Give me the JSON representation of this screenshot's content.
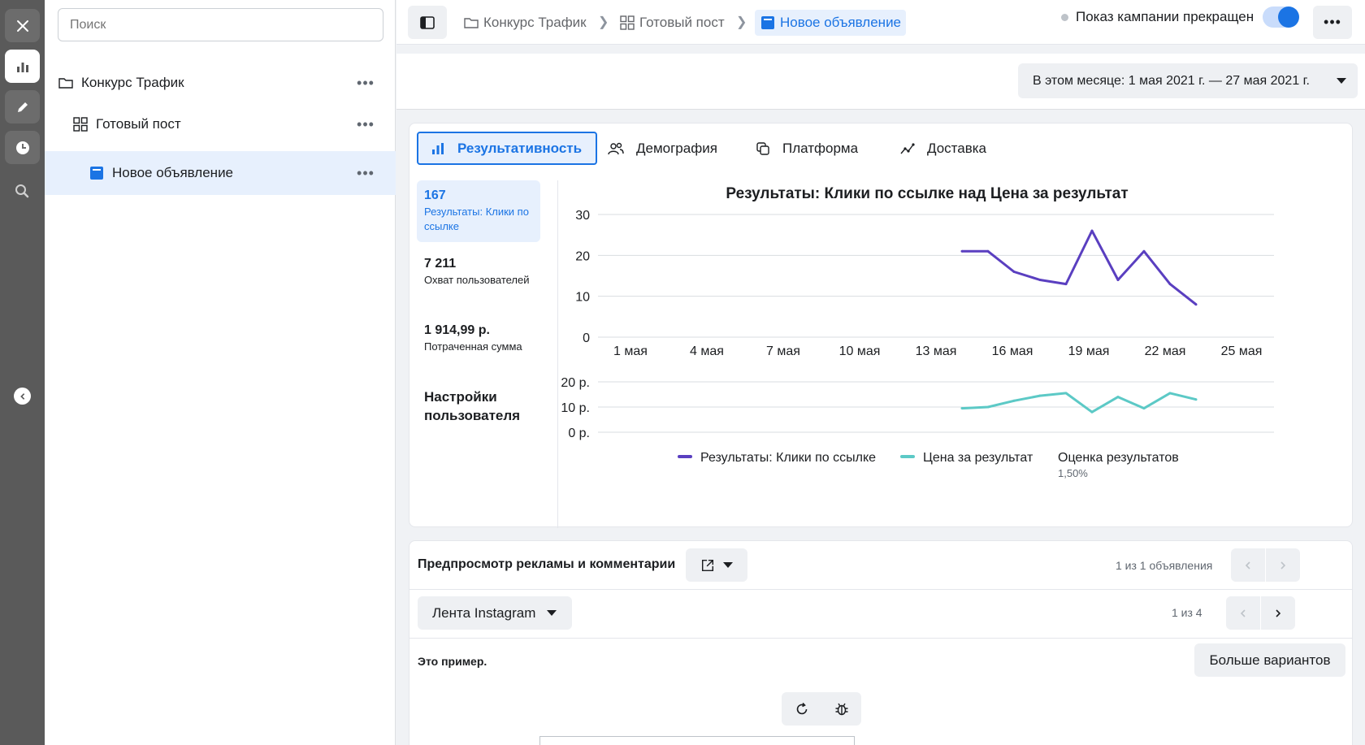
{
  "sidebar": {
    "search_placeholder": "Поиск",
    "items": [
      {
        "label": "Конкурс Трафик",
        "more": "•••"
      },
      {
        "label": "Готовый пост",
        "more": "•••"
      },
      {
        "label": "Новое объявление",
        "more": "•••"
      }
    ]
  },
  "topbar": {
    "breadcrumbs": [
      "Конкурс Трафик",
      "Готовый пост",
      "Новое объявление"
    ],
    "status": "Показ кампании прекращен",
    "toggle_on": true,
    "more": "•••"
  },
  "date_range": "В этом месяце: 1 мая 2021 г. — 27 мая 2021 г.",
  "tabs": [
    "Результативность",
    "Демография",
    "Платформа",
    "Доставка"
  ],
  "metrics": [
    {
      "value": "167",
      "label": "Результаты: Клики по ссылке"
    },
    {
      "value": "7 211",
      "label": "Охват пользователей"
    },
    {
      "value": "1 914,99 р.",
      "label": "Потраченная сумма"
    }
  ],
  "settings_label": "Настройки пользователя",
  "chart_data": {
    "type": "line",
    "title": "Результаты: Клики по ссылке над Цена за результат",
    "x_ticks": [
      "1 мая",
      "4 мая",
      "7 мая",
      "10 мая",
      "13 мая",
      "16 мая",
      "19 мая",
      "22 мая",
      "25 мая"
    ],
    "x_range": [
      1,
      27
    ],
    "x": [
      15,
      16,
      17,
      18,
      19,
      20,
      21,
      22,
      23,
      24
    ],
    "top": {
      "ylim": [
        0,
        30
      ],
      "y_ticks": [
        "30",
        "20",
        "10",
        "0"
      ],
      "series": [
        {
          "name": "Результаты: Клики по ссылке",
          "color": "#5a3fc0",
          "values": [
            21,
            21,
            16,
            14,
            13,
            26,
            14,
            21,
            13,
            8
          ]
        }
      ]
    },
    "bottom": {
      "ylim": [
        0,
        20
      ],
      "y_ticks": [
        "20 р.",
        "10 р.",
        "0 р."
      ],
      "series": [
        {
          "name": "Цена за результат",
          "color": "#5cc9c6",
          "values": [
            9.5,
            10,
            12.5,
            14.5,
            15.5,
            8,
            14,
            9.5,
            15.5,
            13
          ]
        }
      ]
    },
    "legend": [
      {
        "name": "Результаты: Клики по ссылке",
        "color": "#5a3fc0"
      },
      {
        "name": "Цена за результат",
        "color": "#5cc9c6"
      }
    ],
    "estimate": {
      "label": "Оценка результатов",
      "value": "1,50%"
    },
    "grid": true
  },
  "preview": {
    "title": "Предпросмотр рекламы и комментарии",
    "ads_count": "1 из 1 объявления",
    "placement": "Лента Instagram",
    "placement_count": "1 из 4",
    "example": "Это пример.",
    "more_variants": "Больше вариантов"
  }
}
